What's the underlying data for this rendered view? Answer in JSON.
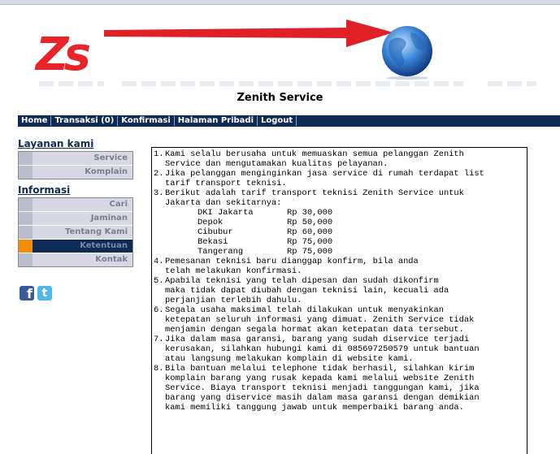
{
  "header": {
    "logo_text": "Zs",
    "site_title": "Zenith Service"
  },
  "nav": {
    "items": [
      {
        "label": "Home"
      },
      {
        "label": "Transaksi (0)"
      },
      {
        "label": "Konfirmasi"
      },
      {
        "label": "Halaman Pribadi"
      },
      {
        "label": "Logout"
      }
    ]
  },
  "sidebar": {
    "layanan_title": "Layanan kami",
    "layanan_items": [
      {
        "label": "Service"
      },
      {
        "label": "Komplain"
      }
    ],
    "informasi_title": "Informasi",
    "informasi_items": [
      {
        "label": "Cari"
      },
      {
        "label": "Jaminan"
      },
      {
        "label": "Tentang Kami"
      },
      {
        "label": "Ketentuan"
      },
      {
        "label": "Kontak"
      }
    ],
    "active_item": "Ketentuan"
  },
  "social": {
    "facebook_letter": "f",
    "twitter_letter": "t"
  },
  "terms": {
    "items": [
      {
        "num": "1.",
        "text": "Kami selalu berusaha untuk memuaskan semua pelanggan Zenith\nService dan mengutamakan kualitas pelayanan."
      },
      {
        "num": "2.",
        "text": "Jika pelanggan menginginkan jasa service di rumah terdapat list\ntarif transport teknisi."
      },
      {
        "num": "3.",
        "text": "Berikut adalah tarif transport teknisi Zenith Service untuk\nJakarta dan sekitarnya:"
      },
      {
        "num": "4.",
        "text": "Pemesanan teknisi baru dianggap konfirm, bila anda\ntelah melakukan konfirmasi."
      },
      {
        "num": "5.",
        "text": "Apabila teknisi yang telah dipesan dan sudah dikonfirm\nmaka tidak dapat diubah dengan teknisi lain, kecuali ada\nperjanjian terlebih dahulu."
      },
      {
        "num": "6.",
        "text": "Segala usaha maksimal telah dilakukan untuk menyakinkan\nketepatan seluruh informasi yang dimuat. Zenith Service tidak\nmenjamin dengan segala hormat akan ketepatan data tersebut."
      },
      {
        "num": "7.",
        "text": "Jika dalam masa garansi, barang yang sudah diservice terjadi\nkerusakan, silahkan hubungi kami di 085697250579 untuk bantuan\natau langsung melakukan komplain di website kami."
      },
      {
        "num": "8.",
        "text": "Bila bantuan melalui telephone tidak berhasil, silahkan kirim\nkomplain barang yang rusak kepada kami melalui website Zenith\nService. Biaya transport teknisi menjadi tanggungan kami, jika\nbarang yang diservice masih dalam masa garansi dengan demikian\nkami memiliki tanggung jawab untuk memperbaiki barang anda."
      }
    ],
    "rates": [
      {
        "city": "DKI Jakarta",
        "price": "Rp 30,000"
      },
      {
        "city": "Depok",
        "price": "Rp 50,000"
      },
      {
        "city": "Cibubur",
        "price": "Rp 60,000"
      },
      {
        "city": "Bekasi",
        "price": "Rp 75,000"
      },
      {
        "city": "Tangerang",
        "price": "Rp 75,000"
      }
    ]
  },
  "colors": {
    "nav_bg": "#0e2a55",
    "logo_red": "#e8232a",
    "arrow_red": "#e01f26",
    "active_accent": "#f28e00"
  }
}
